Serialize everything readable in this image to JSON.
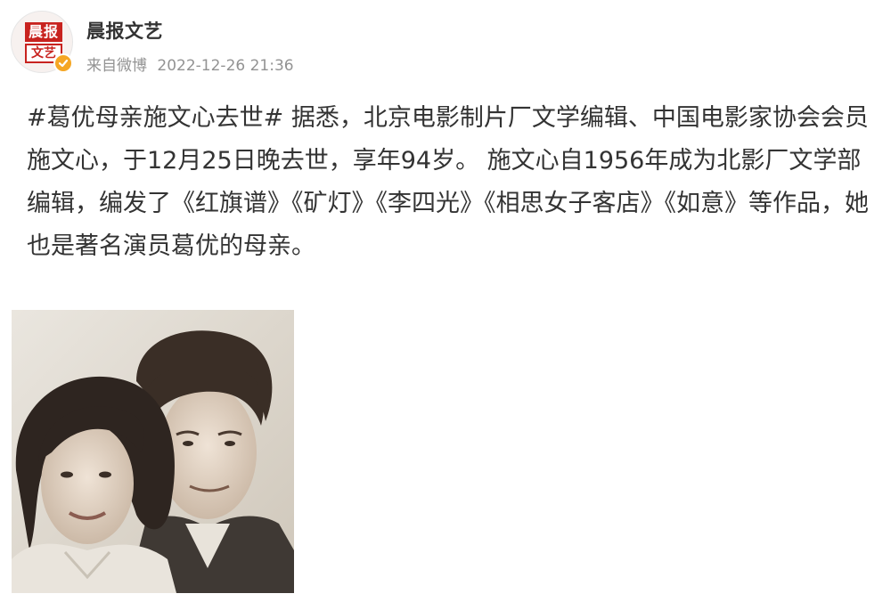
{
  "author": {
    "name": "晨报文艺",
    "avatar_text_top": "晨报",
    "avatar_text_bottom": "文艺",
    "verified_icon": "verified-badge-icon",
    "brand_color": "#c8231f",
    "verified_color": "#f5a623"
  },
  "meta": {
    "source": "来自微博",
    "timestamp": "2022-12-26 21:36"
  },
  "post": {
    "hashtag": "#葛优母亲施文心去世#",
    "body": " 据悉，北京电影制片厂文学编辑、中国电影家协会会员施文心，于12月25日晚去世，享年94岁。 施文心自1956年成为北影厂文学部编辑，编发了《红旗谱》《矿灯》《李四光》《相思女子客店》《如意》等作品，她也是著名演员葛优的母亲。"
  },
  "photo": {
    "icon": "vintage-portrait-photo"
  }
}
